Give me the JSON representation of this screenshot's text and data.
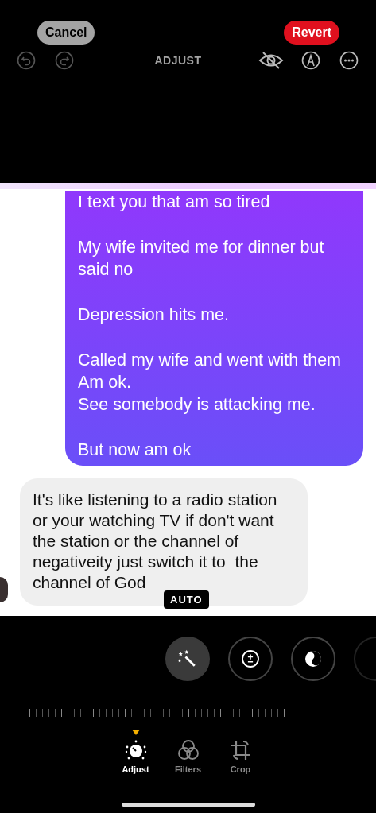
{
  "header": {
    "cancel": "Cancel",
    "revert": "Revert",
    "title": "ADJUST"
  },
  "photo": {
    "outgoing": [
      "I text you that am so tired",
      "My wife invited me for dinner but said no",
      "Depression hits me.",
      "Called my wife and went with them\nAm ok.\nSee somebody is attacking me.",
      "But now am ok"
    ],
    "incoming": "It's like listening to a radio station or your watching TV if don't want the station or the channel of negativeity just switch it to  the channel of God"
  },
  "badge": "AUTO",
  "tools": [
    {
      "kind": "auto",
      "selected": true
    },
    {
      "kind": "exposure",
      "selected": false
    },
    {
      "kind": "brilliance",
      "selected": false
    },
    {
      "kind": "more",
      "selected": false
    }
  ],
  "tabs": [
    {
      "kind": "adjust",
      "label": "Adjust",
      "selected": true
    },
    {
      "kind": "filters",
      "label": "Filters",
      "selected": false
    },
    {
      "kind": "crop",
      "label": "Crop",
      "selected": false
    }
  ]
}
